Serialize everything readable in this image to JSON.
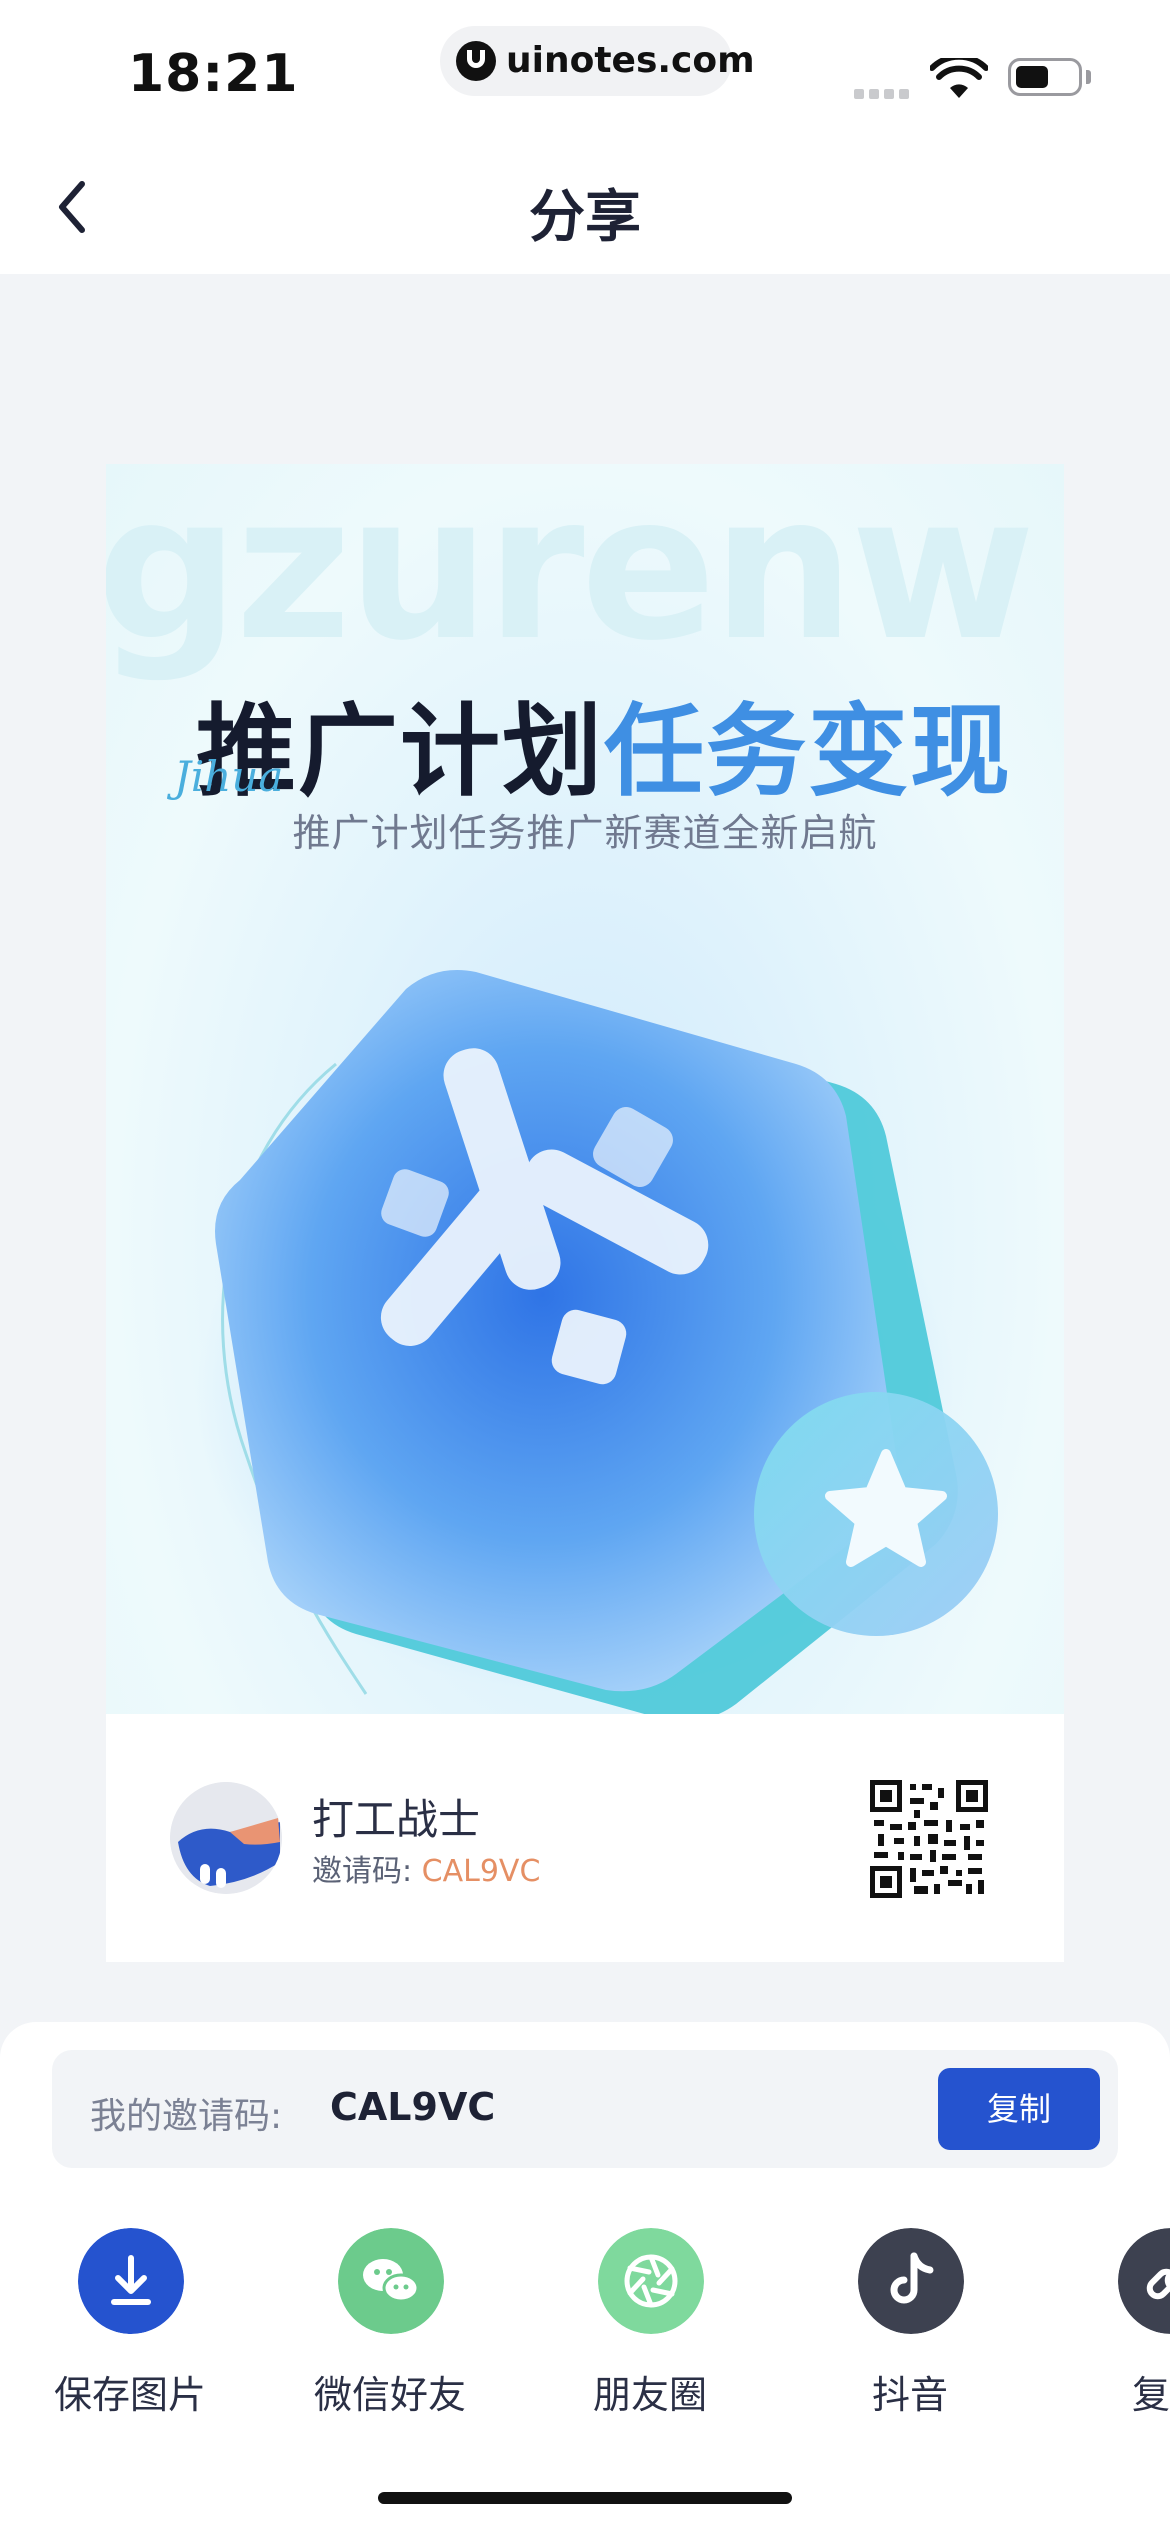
{
  "status_bar": {
    "time": "18:21",
    "url": "uinotes.com"
  },
  "nav": {
    "title": "分享"
  },
  "poster": {
    "watermark": "gzurenw",
    "headline_dark": "推广计划",
    "headline_blue": "任务变现",
    "script_text": "Jihua",
    "subtitle": "推广计划任务推广新赛道全新启航"
  },
  "card": {
    "user_name": "打工战士",
    "invite_label": "邀请码:",
    "invite_code": "CAL9VC"
  },
  "invite_bar": {
    "label": "我的邀请码:",
    "code": "CAL9VC",
    "copy_button": "复制"
  },
  "share_actions": [
    {
      "label": "保存图片",
      "icon": "download-icon",
      "color": "#2553CF"
    },
    {
      "label": "微信好友",
      "icon": "wechat-icon",
      "color": "#6CCB8C"
    },
    {
      "label": "朋友圈",
      "icon": "moments-icon",
      "color": "#7FD99D"
    },
    {
      "label": "抖音",
      "icon": "douyin-icon",
      "color": "#3D4150"
    },
    {
      "label": "复制",
      "icon": "link-icon",
      "color": "#3D4150"
    }
  ],
  "colors": {
    "accent": "#2553CF",
    "invite_code": "#E58F64",
    "page_bg": "#F2F4F7"
  }
}
